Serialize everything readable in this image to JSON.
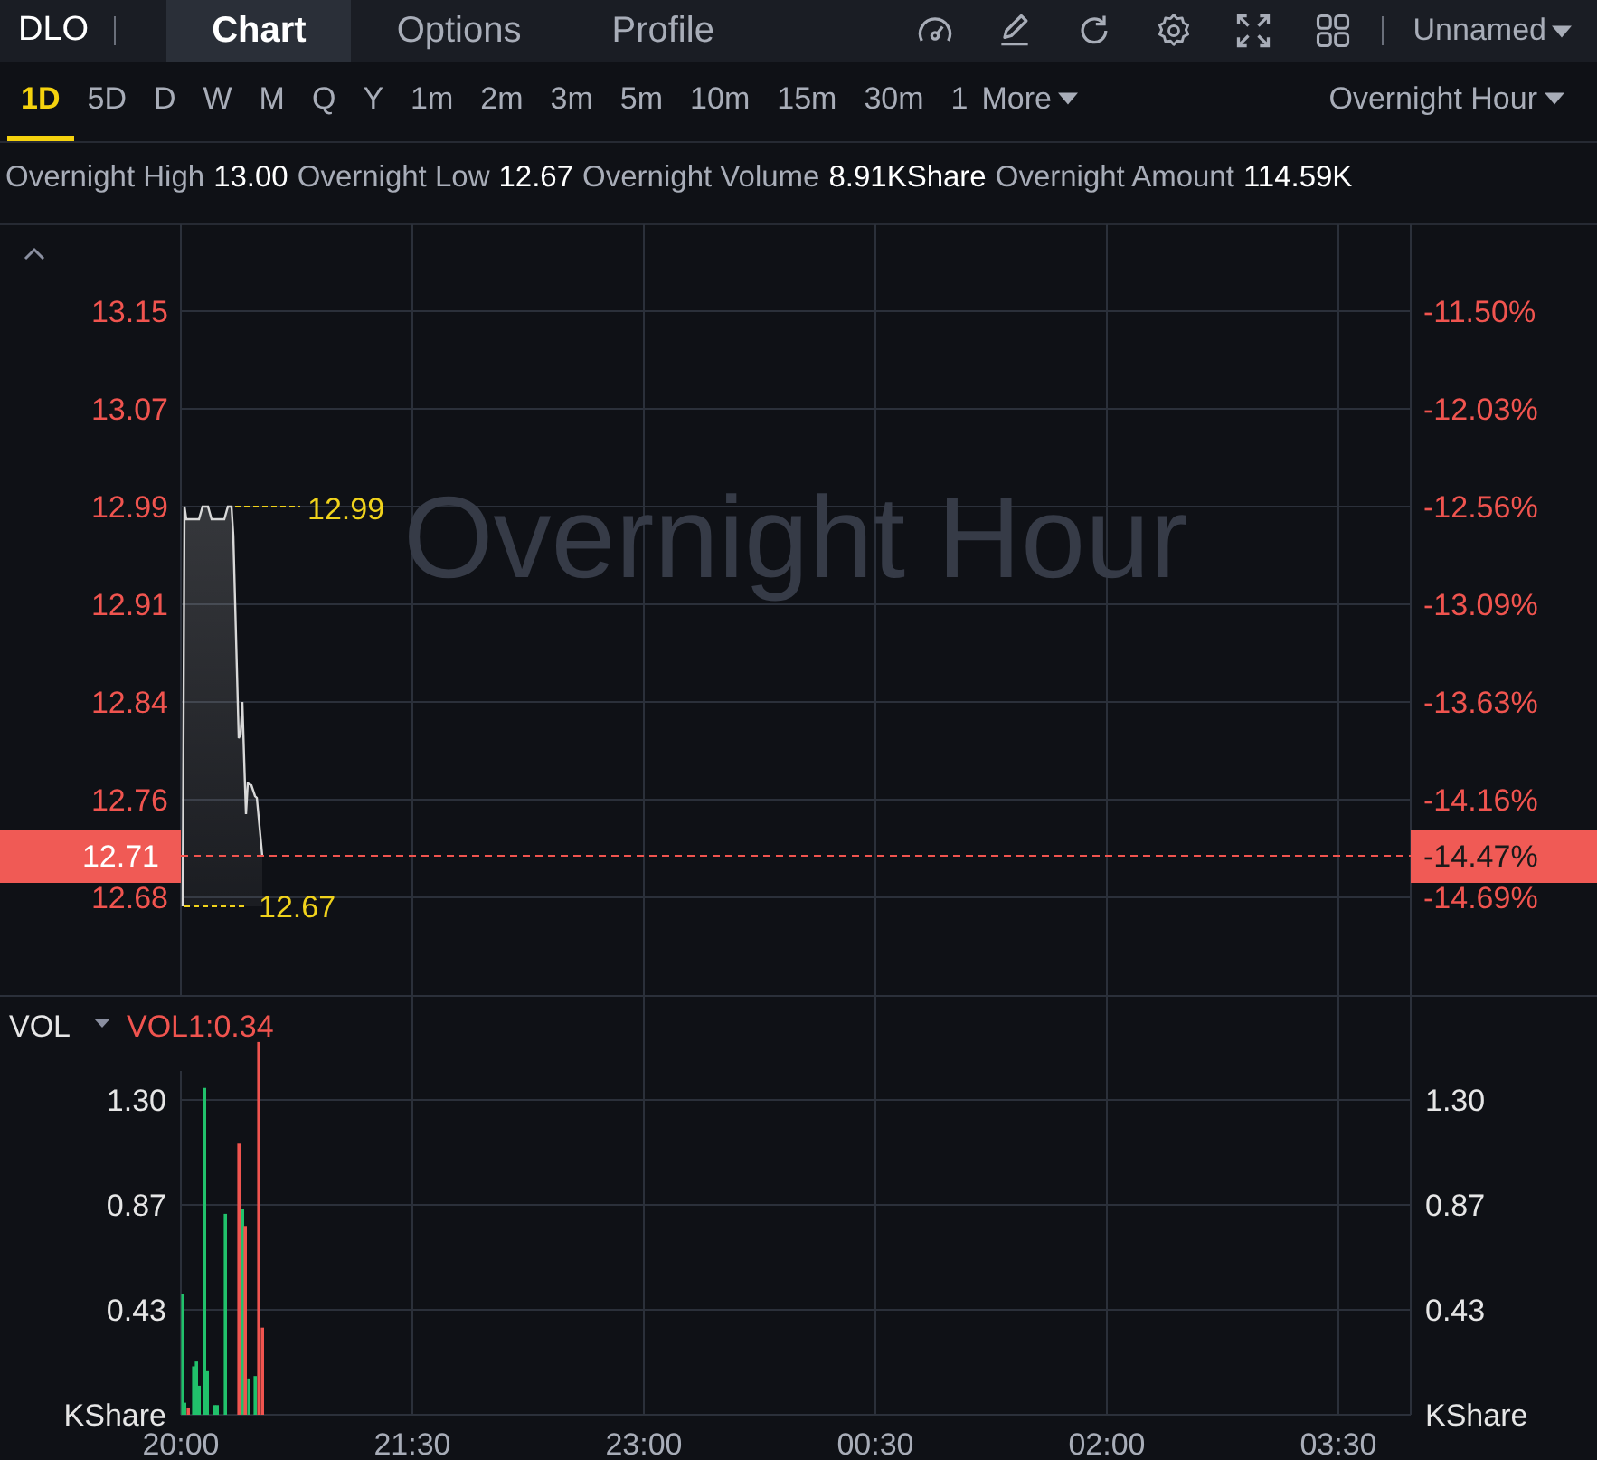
{
  "header": {
    "symbol": "DLO",
    "tabs": [
      {
        "label": "Chart",
        "selected": true
      },
      {
        "label": "Options",
        "selected": false
      },
      {
        "label": "Profile",
        "selected": false
      }
    ],
    "layout_name": "Unnamed"
  },
  "timeframes": [
    {
      "label": "1D",
      "selected": true
    },
    {
      "label": "5D",
      "selected": false
    },
    {
      "label": "D",
      "selected": false
    },
    {
      "label": "W",
      "selected": false
    },
    {
      "label": "M",
      "selected": false
    },
    {
      "label": "Q",
      "selected": false
    },
    {
      "label": "Y",
      "selected": false
    },
    {
      "label": "1m",
      "selected": false
    },
    {
      "label": "2m",
      "selected": false
    },
    {
      "label": "3m",
      "selected": false
    },
    {
      "label": "5m",
      "selected": false
    },
    {
      "label": "10m",
      "selected": false
    },
    {
      "label": "15m",
      "selected": false
    },
    {
      "label": "30m",
      "selected": false
    },
    {
      "label": "1",
      "selected": false
    }
  ],
  "more_menu": "More",
  "session_menu": "Overnight Hour",
  "stats": [
    {
      "label": "Overnight High",
      "value": "13.00"
    },
    {
      "label": "Overnight Low",
      "value": "12.67"
    },
    {
      "label": "Overnight Volume",
      "value": "8.91KShare"
    },
    {
      "label": "Overnight Amount",
      "value": "114.59K"
    }
  ],
  "price_pane": {
    "watermark": "Overnight Hour",
    "high_marker": "12.99",
    "low_marker": "12.67",
    "last_price": "12.71",
    "last_change": "-14.47%",
    "left_axis_labels": [
      "13.15",
      "13.07",
      "12.99",
      "12.91",
      "12.84",
      "12.76",
      "12.68"
    ],
    "right_axis_labels": [
      "-11.50%",
      "-12.03%",
      "-12.56%",
      "-13.09%",
      "-13.63%",
      "-14.16%",
      "-14.69%"
    ]
  },
  "volume_pane": {
    "indicator": "VOL",
    "indicator_value": "VOL1:0.34",
    "left_axis_labels": [
      "1.30",
      "0.87",
      "0.43",
      "KShare"
    ],
    "right_axis_labels": [
      "1.30",
      "0.87",
      "0.43",
      "KShare"
    ],
    "time_axis_labels": [
      "20:00",
      "21:30",
      "23:00",
      "00:30",
      "02:00",
      "03:30"
    ]
  }
}
